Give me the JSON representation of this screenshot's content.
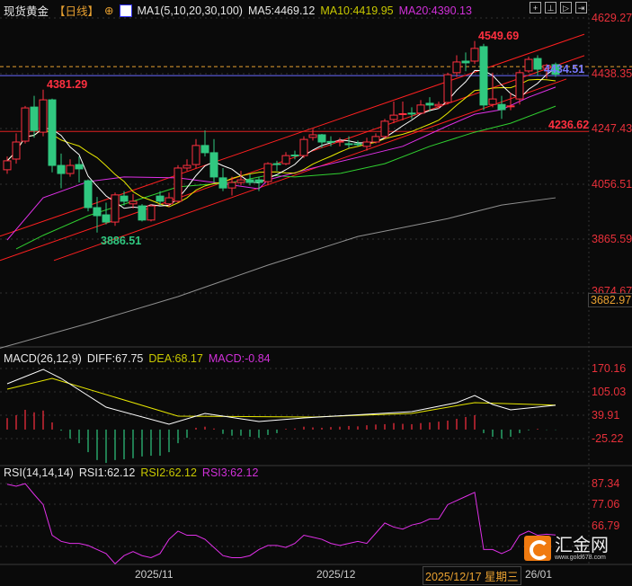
{
  "header": {
    "instrument": "现货黄金",
    "period": "【日线】",
    "ma_title": "MA1(5,10,20,30,100)",
    "ma5": "MA5:4469.12",
    "ma10": "MA10:4419.95",
    "ma20": "MA20:4390.13"
  },
  "toolbar": [
    "crosshair-icon",
    "zoom-in-icon",
    "zoom-out-icon",
    "scroll-end-icon"
  ],
  "macd_header": {
    "title": "MACD(26,12,9)",
    "diff": "DIFF:67.75",
    "dea": "DEA:68.17",
    "macd": "MACD:-0.84"
  },
  "rsi_header": {
    "title": "RSI(14,14,14)",
    "rsi1": "RSI1:62.12",
    "rsi2": "RSI2:62.12",
    "rsi3": "RSI3:62.12"
  },
  "price_axis": [
    "4629.27",
    "4438.35",
    "4247.43",
    "4056.51",
    "3865.59",
    "3674.67"
  ],
  "price_box": "3682.97",
  "macd_axis": [
    "170.16",
    "105.03",
    "39.91",
    "-25.22"
  ],
  "rsi_axis": [
    "87.34",
    "77.06",
    "66.79"
  ],
  "dates": {
    "d1": "2025/11",
    "d2": "2025/12",
    "crosshair": "2025/12/17 星期三",
    "d3": "26/01"
  },
  "annotations": {
    "high": "4549.69",
    "high2": "4381.29",
    "low": "3886.51",
    "level": "4236.62",
    "last": "4434.51"
  },
  "logo": {
    "name": "汇金网",
    "url": "www.gold678.com"
  },
  "colors": {
    "up": "#ff3040",
    "down": "#30c880",
    "ma5": "#ffffff",
    "ma10": "#e8e800",
    "ma20": "#e030e8",
    "ma30": "#30d030",
    "ma100": "#909090",
    "axis": "#e8303a"
  },
  "chart_data": {
    "type": "candlestick",
    "price_range": [
      3674.67,
      4629.27
    ],
    "candles": [
      [
        4104,
        4150,
        4090,
        4135
      ],
      [
        4141,
        4230,
        4125,
        4200
      ],
      [
        4203,
        4325,
        4195,
        4318
      ],
      [
        4321,
        4360,
        4215,
        4240
      ],
      [
        4234,
        4381.29,
        4220,
        4346
      ],
      [
        4346,
        4350,
        4095,
        4119
      ],
      [
        4119,
        4160,
        4040,
        4091
      ],
      [
        4091,
        4140,
        4080,
        4119
      ],
      [
        4122,
        4150,
        4060,
        4107
      ],
      [
        4066,
        4070,
        3960,
        3973
      ],
      [
        3973,
        4010,
        3886.51,
        3945
      ],
      [
        3948,
        3990,
        3915,
        3923
      ],
      [
        3923,
        4025,
        3910,
        4017
      ],
      [
        4013,
        4030,
        3980,
        3995
      ],
      [
        3986,
        4020,
        3970,
        3995
      ],
      [
        3979,
        3985,
        3925,
        3930
      ],
      [
        3930,
        3985,
        3925,
        3979
      ],
      [
        4013,
        4030,
        3980,
        3995
      ],
      [
        3986,
        4025,
        3975,
        4007
      ],
      [
        3995,
        4120,
        3990,
        4110
      ],
      [
        4110,
        4140,
        4100,
        4119
      ],
      [
        4122,
        4210,
        4110,
        4188
      ],
      [
        4188,
        4240,
        4150,
        4163
      ],
      [
        4163,
        4210,
        4060,
        4079
      ],
      [
        4076,
        4110,
        4030,
        4041
      ],
      [
        4041,
        4080,
        4015,
        4060
      ],
      [
        4060,
        4100,
        4050,
        4069
      ],
      [
        4069,
        4090,
        4050,
        4060
      ],
      [
        4069,
        4080,
        4030,
        4060
      ],
      [
        4063,
        4130,
        4050,
        4125
      ],
      [
        4125,
        4135,
        4100,
        4122
      ],
      [
        4125,
        4165,
        4120,
        4153
      ],
      [
        4155,
        4170,
        4140,
        4153
      ],
      [
        4153,
        4220,
        4145,
        4209
      ],
      [
        4216,
        4245,
        4205,
        4225
      ],
      [
        4225,
        4228,
        4180,
        4200
      ],
      [
        4202,
        4220,
        4185,
        4200
      ],
      [
        4200,
        4215,
        4185,
        4203
      ],
      [
        4194,
        4220,
        4180,
        4191
      ],
      [
        4194,
        4205,
        4185,
        4192
      ],
      [
        4185,
        4215,
        4170,
        4200
      ],
      [
        4200,
        4230,
        4195,
        4219
      ],
      [
        4219,
        4280,
        4210,
        4272
      ],
      [
        4278,
        4340,
        4265,
        4293
      ],
      [
        4296,
        4340,
        4275,
        4298
      ],
      [
        4300,
        4320,
        4280,
        4297
      ],
      [
        4300,
        4345,
        4295,
        4328
      ],
      [
        4334,
        4355,
        4305,
        4328
      ],
      [
        4325,
        4340,
        4315,
        4330
      ],
      [
        4337,
        4440,
        4330,
        4433
      ],
      [
        4440,
        4500,
        4425,
        4477
      ],
      [
        4480,
        4510,
        4445,
        4474
      ],
      [
        4480,
        4549.69,
        4470,
        4524
      ],
      [
        4530,
        4540,
        4310,
        4328
      ],
      [
        4330,
        4440,
        4320,
        4349
      ],
      [
        4330,
        4360,
        4280,
        4312
      ],
      [
        4322,
        4370,
        4310,
        4325
      ],
      [
        4349,
        4450,
        4330,
        4440
      ],
      [
        4446,
        4495,
        4440,
        4486
      ],
      [
        4489,
        4500,
        4430,
        4452
      ],
      [
        4455,
        4470,
        4420,
        4465
      ],
      [
        4468,
        4475,
        4425,
        4434.51
      ]
    ],
    "ma20": [
      [
        0,
        3861
      ],
      [
        4,
        4007
      ],
      [
        9,
        4063
      ],
      [
        13,
        4079
      ],
      [
        19,
        4076
      ],
      [
        23,
        4060
      ],
      [
        28,
        4038
      ],
      [
        29,
        4069
      ],
      [
        34,
        4110
      ],
      [
        39,
        4147
      ],
      [
        44,
        4185
      ],
      [
        49,
        4256
      ],
      [
        52,
        4296
      ],
      [
        55,
        4312
      ],
      [
        58,
        4355
      ],
      [
        61,
        4390.13
      ]
    ],
    "ma30": [
      [
        1,
        3830
      ],
      [
        4,
        3877
      ],
      [
        9,
        3945
      ],
      [
        19,
        4045
      ],
      [
        25,
        4060
      ],
      [
        29,
        4085
      ],
      [
        32,
        4079
      ],
      [
        37,
        4091
      ],
      [
        42,
        4125
      ],
      [
        47,
        4185
      ],
      [
        52,
        4234
      ],
      [
        56,
        4265
      ],
      [
        61,
        4324
      ]
    ],
    "ma100": [
      [
        -1,
        3485
      ],
      [
        9,
        3572
      ],
      [
        19,
        3665
      ],
      [
        29,
        3774
      ],
      [
        39,
        3873
      ],
      [
        49,
        3935
      ],
      [
        55,
        3982
      ],
      [
        61,
        4007
      ]
    ],
    "channel_lines": [
      [
        [
          -0.8,
          3874
        ],
        [
          64.2,
          4573
        ]
      ],
      [
        [
          -0.8,
          3790
        ],
        [
          64.2,
          4499
        ]
      ],
      [
        [
          5.2,
          3790
        ],
        [
          62.2,
          4418
        ]
      ]
    ],
    "hlines": {
      "red": 4236.62,
      "blue": 4430,
      "orange_dashed": 4461
    },
    "macd": {
      "range": [
        -25.22,
        170.16
      ],
      "diff": [
        [
          0,
          127.6
        ],
        [
          4,
          167.7
        ],
        [
          6,
          142.6
        ],
        [
          11,
          62.4
        ],
        [
          18,
          14.9
        ],
        [
          22,
          44.9
        ],
        [
          28,
          22.4
        ],
        [
          33,
          32.4
        ],
        [
          45,
          50
        ],
        [
          50,
          75
        ],
        [
          52,
          95
        ],
        [
          54,
          70
        ],
        [
          56,
          55
        ],
        [
          61,
          67.75
        ]
      ],
      "dea": [
        [
          0,
          112.6
        ],
        [
          5,
          142.6
        ],
        [
          19,
          37.4
        ],
        [
          34,
          34.9
        ],
        [
          45,
          45
        ],
        [
          52,
          75
        ],
        [
          61,
          68.17
        ]
      ],
      "hist": [
        32,
        40,
        55,
        48,
        53,
        20,
        -3,
        -25,
        -38,
        -63,
        -85,
        -93,
        -85,
        -83,
        -80,
        -75,
        -73,
        -73,
        -63,
        -38,
        -23,
        5,
        8,
        3,
        -12,
        -17,
        -17,
        -20,
        -23,
        -15,
        -10,
        2,
        3,
        8,
        6,
        5,
        7,
        8,
        10,
        9,
        12,
        14,
        15,
        18,
        16,
        15,
        18,
        20,
        22,
        25,
        30,
        35,
        40,
        -10,
        -20,
        -25,
        -20,
        -10,
        -2,
        2,
        -1,
        -1
      ]
    },
    "rsi": {
      "range": [
        56.5,
        87.34
      ],
      "values": [
        87,
        86,
        87.3,
        82,
        77,
        62,
        59,
        58,
        58,
        57,
        55,
        53,
        48,
        52,
        54,
        52,
        51,
        53,
        60,
        64,
        62,
        62,
        60,
        56,
        52,
        51,
        51,
        52,
        55,
        57,
        57,
        56,
        58,
        62,
        61,
        60,
        58,
        57,
        58,
        59,
        58,
        63,
        68,
        66,
        65,
        67,
        68,
        70,
        70,
        77,
        79,
        81,
        83,
        55,
        55,
        53,
        55,
        62,
        64,
        62,
        62.5,
        62.12
      ]
    }
  }
}
